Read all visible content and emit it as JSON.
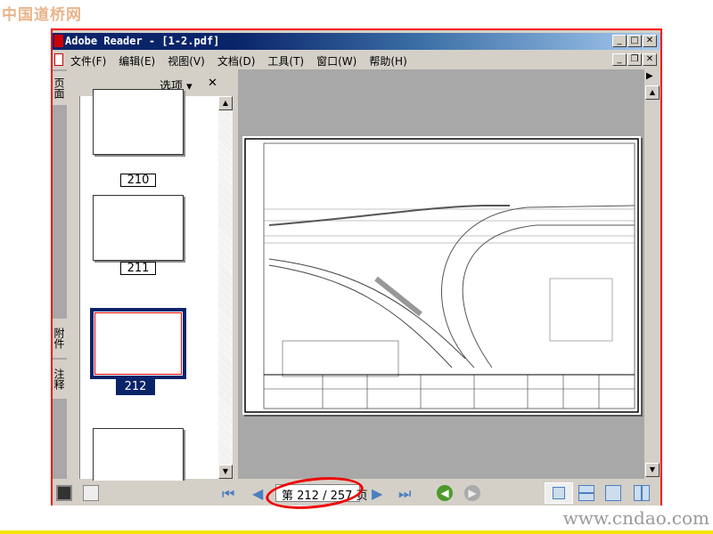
{
  "watermark_top": "中国道桥网",
  "watermark_bottom": "www.cndao.com",
  "window": {
    "title": "Adobe Reader - [1-2.pdf]"
  },
  "menu": [
    "文件(F)",
    "编辑(E)",
    "视图(V)",
    "文档(D)",
    "工具(T)",
    "窗口(W)",
    "帮助(H)"
  ],
  "sidebar": {
    "options_label": "选项 ▾",
    "close": "✕",
    "tabs": [
      "页面",
      "附件",
      "注释"
    ],
    "thumbnails": [
      {
        "page": "210"
      },
      {
        "page": "211"
      },
      {
        "page": "212",
        "selected": true
      }
    ]
  },
  "nav": {
    "page_indicator": "第 212 / 257 页",
    "current_page": 212,
    "total_pages": 257
  },
  "colors": {
    "accent_red": "#ff0000",
    "title_blue": "#0a246a",
    "selection": "#0a246a"
  }
}
